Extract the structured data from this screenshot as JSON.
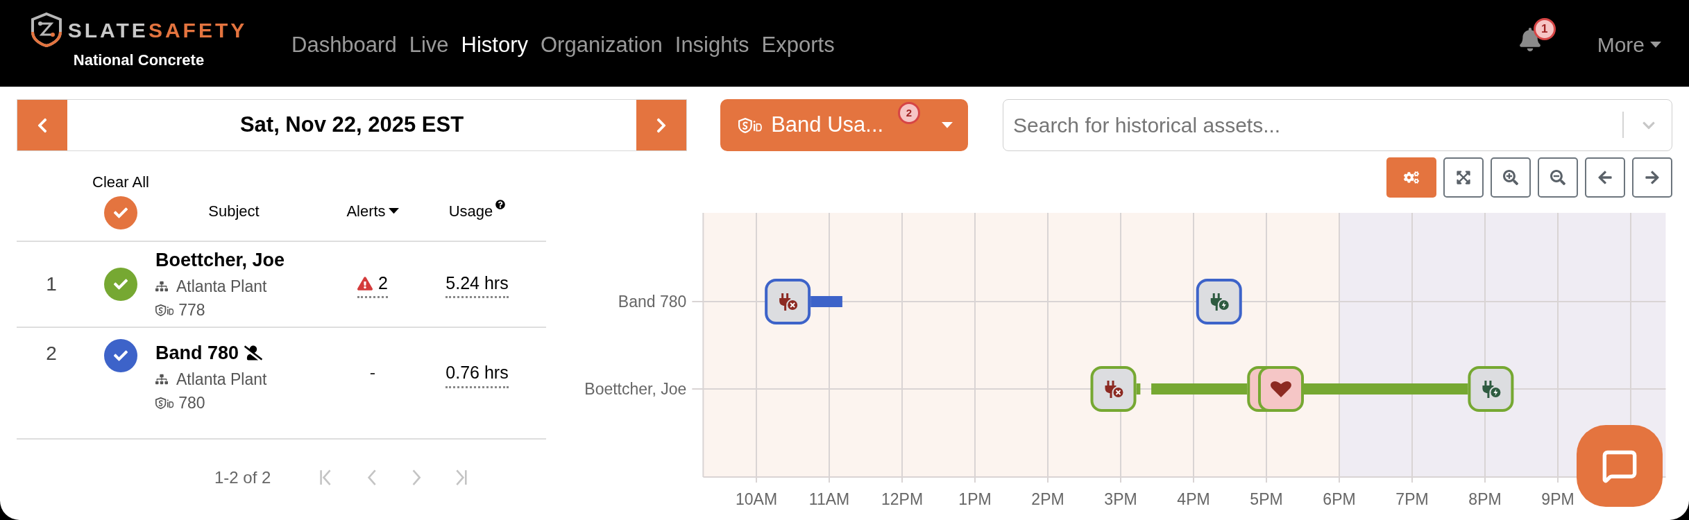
{
  "header": {
    "logo": {
      "text": "SLATE",
      "accent": "SAFETY"
    },
    "organization": "National Concrete",
    "nav": [
      {
        "label": "Dashboard",
        "selected": false
      },
      {
        "label": "Live",
        "selected": false
      },
      {
        "label": "History",
        "selected": true
      },
      {
        "label": "Organization",
        "selected": false
      },
      {
        "label": "Insights",
        "selected": false
      },
      {
        "label": "Exports",
        "selected": false
      }
    ],
    "notifications": "1",
    "more": "More"
  },
  "date_bar": {
    "date": "Sat, Nov 22, 2025 EST"
  },
  "report_button": {
    "label": "Band Usa...",
    "badge": "2"
  },
  "search": {
    "placeholder": "Search for historical assets..."
  },
  "toolbar": [
    {
      "kind": "settings",
      "selected": true
    },
    {
      "kind": "fit",
      "selected": false
    },
    {
      "kind": "zoom-in",
      "selected": false
    },
    {
      "kind": "zoom-out",
      "selected": false
    },
    {
      "kind": "back",
      "selected": false
    },
    {
      "kind": "forward",
      "selected": false
    }
  ],
  "table": {
    "columns": {
      "select": "Clear All",
      "select_checked": true,
      "subject": "Subject",
      "alerts": "Alerts",
      "usage": "Usage"
    },
    "rows": [
      {
        "index": "1",
        "checked": true,
        "color": "#76a832",
        "name": "Boettcher, Joe",
        "unassigned": false,
        "site": "Atlanta Plant",
        "band": "778",
        "alerts": "2",
        "has_alerts": true,
        "usage": "5.24 hrs"
      },
      {
        "index": "2",
        "checked": true,
        "color": "#3d63c9",
        "name": "Band 780",
        "unassigned": true,
        "site": "Atlanta Plant",
        "band": "780",
        "alerts": "-",
        "has_alerts": false,
        "usage": "0.76 hrs"
      }
    ],
    "pagination": {
      "range": "1-2 of 2",
      "buttons": [
        {
          "kind": "first",
          "disabled": true
        },
        {
          "kind": "prev",
          "disabled": true
        },
        {
          "kind": "next",
          "disabled": true
        },
        {
          "kind": "last",
          "disabled": true
        }
      ]
    }
  },
  "timeline": {
    "ticks": [
      "10AM",
      "11AM",
      "12PM",
      "1PM",
      "2PM",
      "3PM",
      "4PM",
      "5PM",
      "6PM",
      "7PM",
      "8PM",
      "9PM"
    ],
    "rows": [
      {
        "name": "Band 780",
        "color": "#3d63c9",
        "events": [
          {
            "kind": "unplugged"
          },
          {
            "kind": "charging"
          }
        ]
      },
      {
        "name": "Boettcher, Joe",
        "color": "#76a832",
        "events": [
          {
            "kind": "unplugged"
          },
          {
            "kind": "heart"
          },
          {
            "kind": "heart"
          },
          {
            "kind": "charging"
          }
        ]
      }
    ]
  }
}
